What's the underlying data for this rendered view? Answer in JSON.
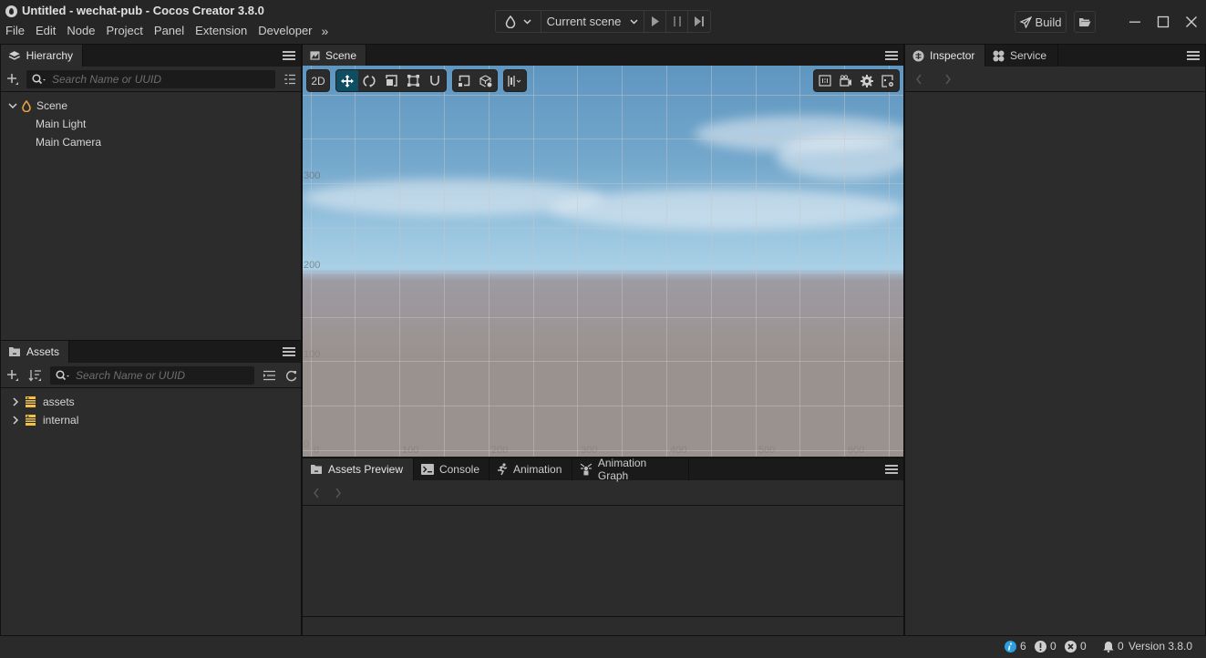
{
  "window": {
    "title": "Untitled - wechat-pub - Cocos Creator 3.8.0"
  },
  "menu": {
    "items": [
      "File",
      "Edit",
      "Node",
      "Project",
      "Panel",
      "Extension",
      "Developer"
    ],
    "more_icon": "double-chevron-right"
  },
  "play_toolbar": {
    "scene_select": "Current scene",
    "platform_icon": "drop-icon"
  },
  "toolbar_right": {
    "build_label": "Build"
  },
  "hierarchy": {
    "tab_label": "Hierarchy",
    "search_placeholder": "Search Name or UUID",
    "tree": [
      {
        "label": "Scene",
        "level": 0,
        "expanded": true,
        "icon": "scene-icon"
      },
      {
        "label": "Main Light",
        "level": 1
      },
      {
        "label": "Main Camera",
        "level": 1
      }
    ]
  },
  "assets": {
    "tab_label": "Assets",
    "search_placeholder": "Search Name or UUID",
    "tree": [
      {
        "label": "assets",
        "expanded": false,
        "icon": "database-icon"
      },
      {
        "label": "internal",
        "expanded": false,
        "icon": "database-icon"
      }
    ]
  },
  "scene": {
    "tab_label": "Scene",
    "mode_2d_label": "2D",
    "active_tool": "move",
    "axis": {
      "x_labels": [
        "0",
        "100",
        "200",
        "300",
        "400",
        "500",
        "600"
      ],
      "y_labels": [
        "0",
        "100",
        "200",
        "300"
      ]
    }
  },
  "inspector": {
    "tabs": [
      {
        "label": "Inspector",
        "active": true
      },
      {
        "label": "Service",
        "active": false
      }
    ]
  },
  "bottom_panel": {
    "tabs": [
      {
        "label": "Assets Preview",
        "active": true
      },
      {
        "label": "Console",
        "active": false
      },
      {
        "label": "Animation",
        "active": false
      },
      {
        "label": "Animation Graph",
        "active": false
      }
    ]
  },
  "status": {
    "info_count": "6",
    "warning_count": "0",
    "error_count": "0",
    "notification_count": "0",
    "version": "Version 3.8.0",
    "info_color": "#2b9fe0"
  }
}
